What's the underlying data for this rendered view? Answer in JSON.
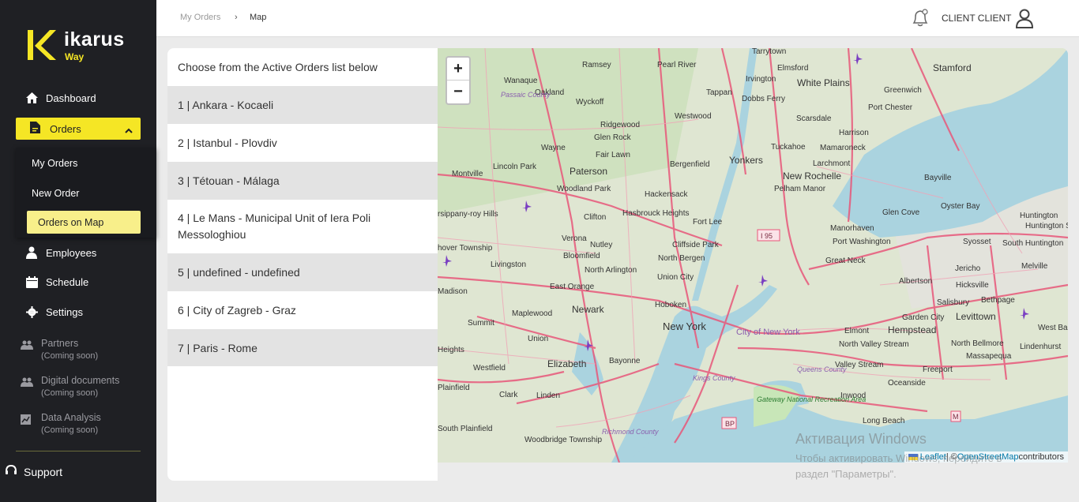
{
  "brand": {
    "name": "ikarus",
    "sub": "Way"
  },
  "sidebar": {
    "dashboard": "Dashboard",
    "orders": "Orders",
    "sub": {
      "my_orders": "My Orders",
      "new_order": "New Order",
      "orders_on_map": "Orders on Map"
    },
    "employees": "Employees",
    "schedule": "Schedule",
    "settings": "Settings",
    "partners": "Partners",
    "digital_documents": "Digital documents",
    "data_analysis": "Data Analysis",
    "coming_soon": "(Coming soon)",
    "support": "Support"
  },
  "breadcrumb": {
    "first": "My Orders",
    "sep": "›",
    "current": "Map"
  },
  "header": {
    "user_name": "CLIENT CLIENT"
  },
  "orders_panel": {
    "heading": "Choose from the Active Orders list below",
    "items": [
      "1 | Ankara - Kocaeli",
      "2 | Istanbul - Plovdiv",
      "3 | Tétouan - Málaga",
      "4 | Le Mans - Municipal Unit of Iera Poli Messologhiou",
      "5 | undefined - undefined",
      "6 | City of Zagreb - Graz",
      "7 | Paris - Rome"
    ]
  },
  "map": {
    "zoom_in": "+",
    "zoom_out": "−",
    "attribution": {
      "leaflet": "Leaflet",
      "sep": " | © ",
      "osm": "OpenStreetMap",
      "suffix": " contributors"
    },
    "labels": {
      "tarrytown": "Tarrytown",
      "ramsey": "Ramsey",
      "pearl_river": "Pearl River",
      "elmsford": "Elmsford",
      "white_plains": "White Plains",
      "stamford": "Stamford",
      "wanaque": "Wanaque",
      "oakland": "Oakland",
      "irvington": "Irvington",
      "greenwich": "Greenwich",
      "passaic_county": "Passaic County",
      "wyckoff": "Wyckoff",
      "tappan": "Tappan",
      "dobbs_ferry": "Dobbs Ferry",
      "port_chester": "Port Chester",
      "westwood": "Westwood",
      "scarsdale": "Scarsdale",
      "ridgewood": "Ridgewood",
      "glen_rock": "Glen Rock",
      "harrison": "Harrison",
      "wayne": "Wayne",
      "fair_lawn": "Fair Lawn",
      "tuckahoe": "Tuckahoe",
      "mamaroneck": "Mamaroneck",
      "lincoln_park": "Lincoln Park",
      "bergenfield": "Bergenfield",
      "yonkers": "Yonkers",
      "larchmont": "Larchmont",
      "montville": "Montville",
      "paterson": "Paterson",
      "new_rochelle": "New Rochelle",
      "bayville": "Bayville",
      "woodland_park": "Woodland Park",
      "hackensack": "Hackensack",
      "pelham_manor": "Pelham Manor",
      "troy_hills": "rsippany-roy Hills",
      "clifton": "Clifton",
      "hasbrouck_heights": "Hasbrouck Heights",
      "fort_lee": "Fort Lee",
      "oyster_bay": "Oyster Bay",
      "glen_cove": "Glen Cove",
      "huntington": "Huntington",
      "huntington_station": "Huntington Station",
      "verona": "Verona",
      "manorhaven": "Manorhaven",
      "i95": "I 95",
      "nutley": "Nutley",
      "cliffside_park": "Cliffside Park",
      "port_washington": "Port Washington",
      "syosset": "Syosset",
      "hanover_township": "hover Township",
      "bloomfield": "Bloomfield",
      "livingston": "Livingston",
      "north_bergen": "North Bergen",
      "great_neck": "Great Neck",
      "jericho": "Jericho",
      "south_huntington": "South Huntington",
      "north_arlington": "North Arlington",
      "union_city": "Union City",
      "melville": "Melville",
      "albertson": "Albertson",
      "hicksville": "Hicksville",
      "east_orange": "East Orange",
      "madison": "Madison",
      "newark": "Newark",
      "hoboken": "Hoboken",
      "salisbury": "Salisbury",
      "bethpage": "Bethpage",
      "maplewood": "Maplewood",
      "summit": "Summit",
      "new_york": "New York",
      "garden_city": "Garden City",
      "levittown": "Levittown",
      "hempstead": "Hempstead",
      "west_babylon": "West Bab",
      "city_of_new_york": "City of New York",
      "elmont": "Elmont",
      "union": "Union",
      "north_valley_stream": "North Valley Stream",
      "north_bellmore": "North Bellmore",
      "lindenhurst": "Lindenhurst",
      "heights": "Heights",
      "westfield": "Westfield",
      "elizabeth": "Elizabeth",
      "bayonne": "Bayonne",
      "valley_stream": "Valley Stream",
      "freeport": "Freeport",
      "massapequa": "Massapequa",
      "queens_county": "Queens County",
      "kings_county": "Kings County",
      "plainfield": "Plainfield",
      "clark": "Clark",
      "linden": "Linden",
      "oceanside": "Oceanside",
      "inwood": "Inwood",
      "gateway": "Gateway National Recreation Area",
      "long_beach": "Long Beach",
      "bp": "BP",
      "m": "M",
      "south_plainfield": "South Plainfield",
      "richmond_county": "Richmond County",
      "woodbridge_township": "Woodbridge Township"
    }
  },
  "watermark": {
    "title": "Активация Windows",
    "line1": "Чтобы активировать Windows, перейдите в",
    "line2": "раздел \"Параметры\"."
  },
  "colors": {
    "accent": "#f5e625",
    "sidebar_bg": "#1f2024",
    "water": "#aad3df",
    "road_major": "#e8577a",
    "road_minor": "#f0a3b6"
  }
}
